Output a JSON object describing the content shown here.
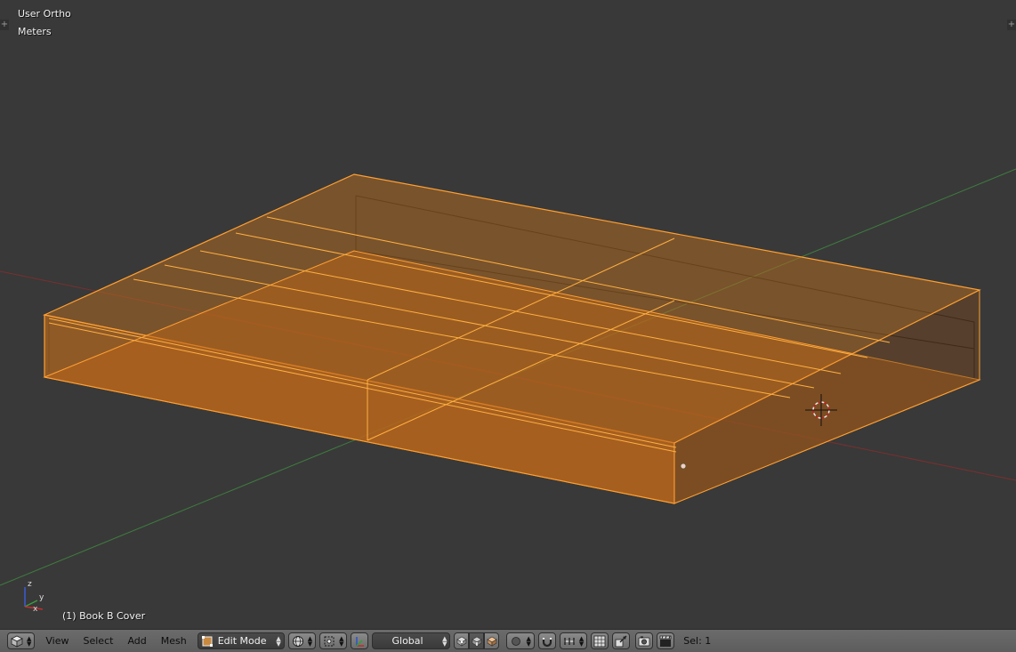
{
  "viewport": {
    "view_name": "User Ortho",
    "units": "Meters",
    "object_label": "(1) Book B Cover",
    "axis_labels": {
      "x": "x",
      "y": "y",
      "z": "z"
    }
  },
  "colors": {
    "background": "#393939",
    "selection": "#ffa032",
    "face_fill": "#b5681f",
    "x_axis": "#8a3030",
    "y_axis": "#3d8a3d"
  },
  "header": {
    "editor_type_icon": "3d-view-cube-icon",
    "menus": [
      "View",
      "Select",
      "Add",
      "Mesh"
    ],
    "mode": "Edit Mode",
    "viewport_shading_icon": "sphere-shading-icon",
    "pivot_icon": "pivot-bounding-box-icon",
    "transform_orientation": "Global",
    "select_mode_icons": [
      "vertex-select-icon",
      "edge-select-icon",
      "face-select-icon"
    ],
    "proportional_edit_icon": "proportional-edit-icon",
    "snap_icon": "snap-magnet-icon",
    "snap_element_icon": "snap-increment-icon",
    "render_icons": [
      "render-still-icon",
      "render-animation-icon"
    ],
    "status_text": "Sel: 1"
  }
}
